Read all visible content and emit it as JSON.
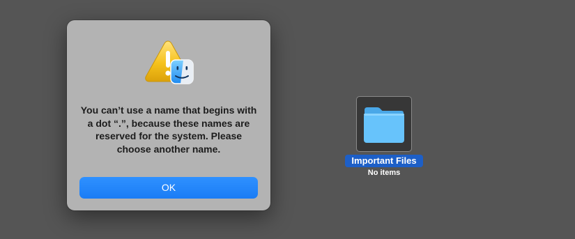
{
  "alert": {
    "icon": "warning-triangle-with-finder-badge",
    "message": "You can’t use a name that begins with a dot “.”, because these names are reserved for the system. Please choose another name.",
    "ok_label": "OK",
    "button_color": "#1e83fb"
  },
  "desktop": {
    "background": "#555555",
    "folder": {
      "icon": "folder-icon",
      "name": "Important Files",
      "subtitle": "No items",
      "selection_color": "#1d5fc7"
    }
  }
}
